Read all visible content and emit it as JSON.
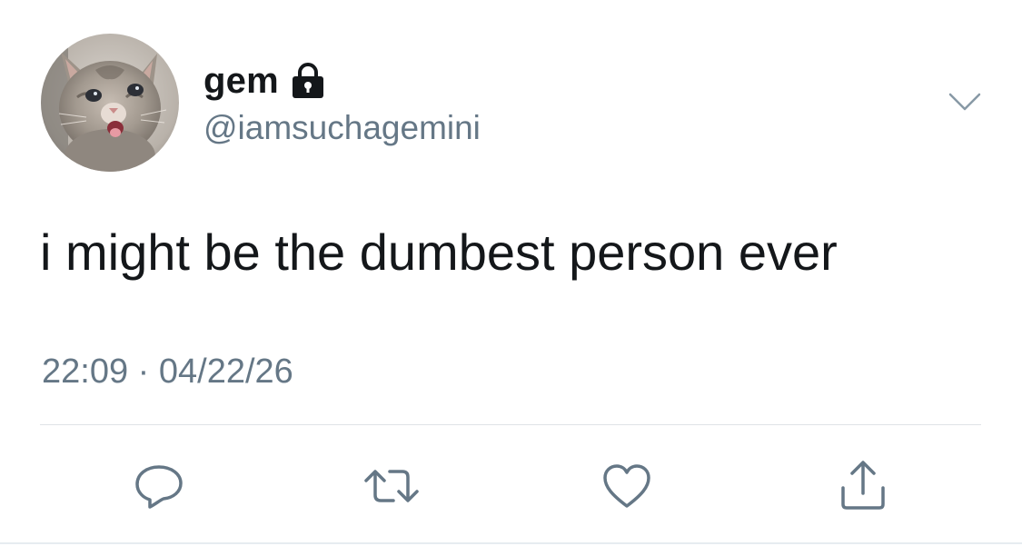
{
  "tweet": {
    "display_name": "gem",
    "handle": "@iamsuchagemini",
    "text": "i might be the dumbest person ever",
    "timestamp": "22:09 · 04/22/26",
    "account_protected": true
  },
  "icons": {
    "lock": "lock-icon",
    "menu": "chevron-down-icon",
    "reply": "reply-icon",
    "retweet": "retweet-icon",
    "like": "heart-icon",
    "share": "share-icon"
  },
  "colors": {
    "text_primary": "#14171a",
    "text_secondary": "#657786",
    "icon": "#657786",
    "divider": "#dfe3e6"
  }
}
